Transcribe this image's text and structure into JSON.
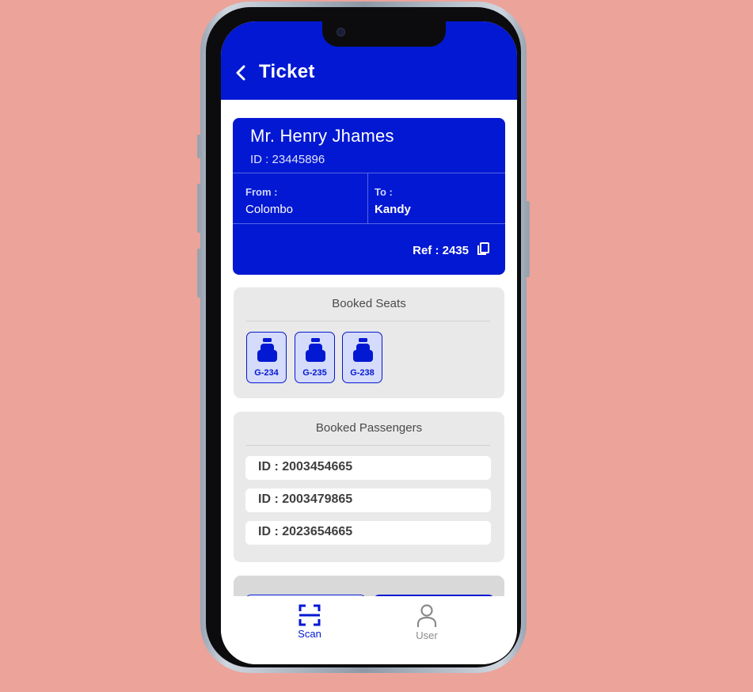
{
  "header": {
    "title": "Ticket",
    "back_icon": "chevron-left-icon"
  },
  "ticket": {
    "name": "Mr. Henry Jhames",
    "id_text": "ID : 23445896",
    "from_label": "From :",
    "from_value": "Colombo",
    "to_label": "To :",
    "to_value": "Kandy",
    "ref_text": "Ref : 2435",
    "copy_icon": "copy-icon"
  },
  "seats": {
    "title": "Booked Seats",
    "items": [
      {
        "label": "G-234"
      },
      {
        "label": "G-235"
      },
      {
        "label": "G-238"
      }
    ]
  },
  "passengers": {
    "title": "Booked Passengers",
    "items": [
      {
        "id_text": "ID : 2003454665"
      },
      {
        "id_text": "ID : 2003479865"
      },
      {
        "id_text": "ID : 2023654665"
      }
    ]
  },
  "tabbar": {
    "items": [
      {
        "label": "Scan",
        "icon": "scan-icon",
        "active": true
      },
      {
        "label": "User",
        "icon": "user-icon",
        "active": false
      }
    ]
  },
  "colors": {
    "primary": "#0318d2",
    "background": "#eba39a",
    "section_bg": "#e9e9e9",
    "seat_bg": "#d5dbfa",
    "inactive_tab": "#8a8a8a"
  }
}
